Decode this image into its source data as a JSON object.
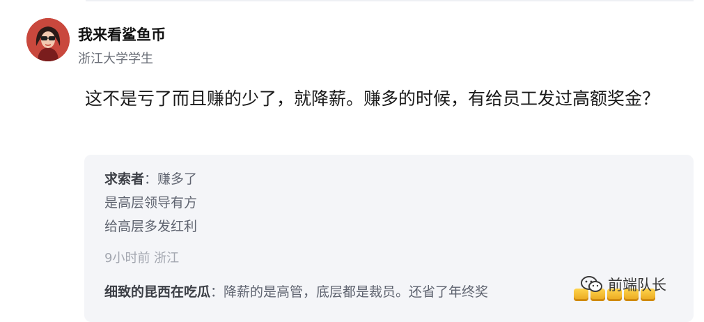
{
  "comment": {
    "author_name": "我来看鲨鱼币",
    "author_bio": "浙江大学学生",
    "text": "这不是亏了而且赚的少了，就降薪。赚多的时候，有给员工发过高额奖金？"
  },
  "reply_1": {
    "name": "求索者",
    "separator": "：",
    "line1": "赚多了",
    "line2": "是高层领导有方",
    "line3": "给高层多发红利",
    "meta": "9小时前 浙江"
  },
  "reply_2": {
    "name": "细致的昆西在吃瓜",
    "separator": "：",
    "text": "降薪的是高管，底层都是裁员。还省了年终奖"
  },
  "watermark": {
    "text": "前端队长"
  },
  "colors": {
    "avatar_bg": "#c9483d",
    "reply_bg": "#f4f5f8",
    "coin": "#f5b62b"
  }
}
